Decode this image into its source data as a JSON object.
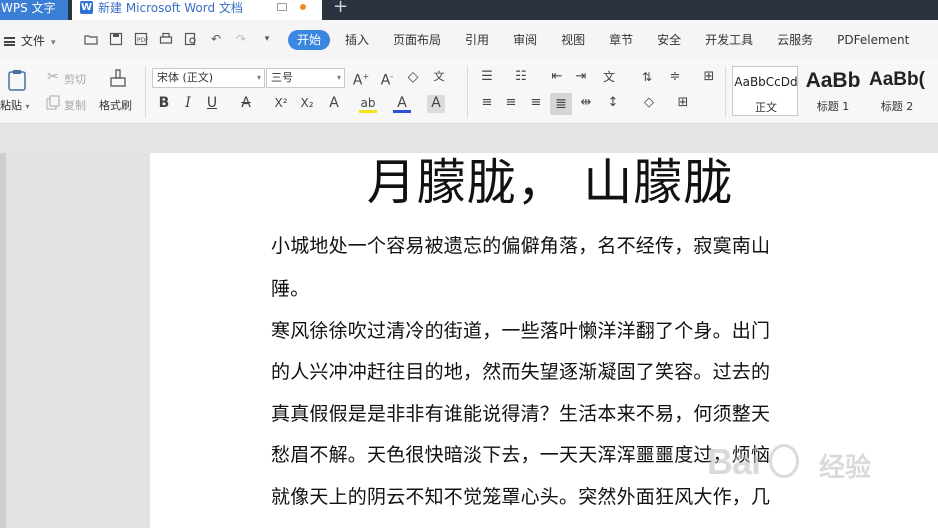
{
  "titlebar": {
    "app_tab": "WPS 文字",
    "doc_tab": "新建 Microsoft Word 文档",
    "new_tab_glyph": "+"
  },
  "menubar": {
    "file_label": "文件",
    "tabs": [
      "开始",
      "插入",
      "页面布局",
      "引用",
      "审阅",
      "视图",
      "章节",
      "安全",
      "开发工具",
      "云服务",
      "PDFelement"
    ],
    "active_tab": "开始"
  },
  "ribbon": {
    "paste": "粘贴",
    "cut": "剪切",
    "copy": "复制",
    "format_painter": "格式刷",
    "font_name": "宋体 (正文)",
    "font_size": "三号",
    "styles": [
      {
        "sample": "AaBbCcDd",
        "name": "正文"
      },
      {
        "sample": "AaBb",
        "name": "标题 1"
      },
      {
        "sample": "AaBb(",
        "name": "标题 2"
      }
    ]
  },
  "document": {
    "title": "月朦胧， 山朦胧",
    "lines": [
      "小城地处一个容易被遗忘的偏僻角落，名不经传，寂寞南山",
      "陲。",
      "寒风徐徐吹过清冷的街道，一些落叶懒洋洋翻了个身。出门",
      "的人兴冲冲赶往目的地，然而失望逐渐凝固了笑容。过去的",
      "真真假假是是非非有谁能说得清？生活本来不易，何须整天",
      "愁眉不解。天色很快暗淡下去，一天天浑浑噩噩度过，烦恼",
      "就像天上的阴云不知不觉笼罩心头。突然外面狂风大作，几"
    ]
  },
  "watermark": {
    "brand": "Bai",
    "suffix": "经验"
  },
  "colors": {
    "titlebar_bg": "#2b3240",
    "app_tab_bg": "#3a7fd5",
    "active_menu_tab": "#3a86e0",
    "ribbon_bg": "#f7f7f7",
    "page_bg": "#ffffff"
  },
  "icons": {
    "paste": "clipboard-icon",
    "cut": "scissors-icon",
    "copy": "copy-icon",
    "format_painter": "brush-icon"
  }
}
